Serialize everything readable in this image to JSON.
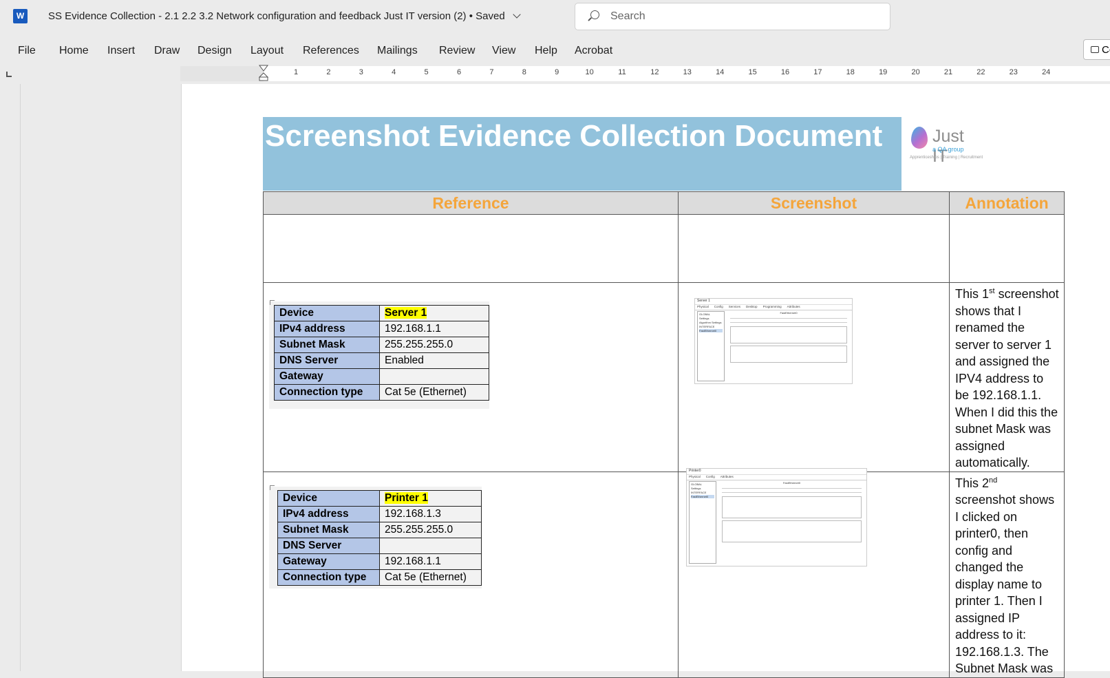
{
  "app": {
    "logo_letter": "W",
    "doc_title": "SS Evidence Collection - 2.1 2.2 3.2 Network configuration and feedback Just IT version (2)",
    "saved_status": "•  Saved",
    "search_placeholder": "Search"
  },
  "menu": [
    "File",
    "Home",
    "Insert",
    "Draw",
    "Design",
    "Layout",
    "References",
    "Mailings",
    "Review",
    "View",
    "Help",
    "Acrobat"
  ],
  "comments_button": "Co",
  "ruler": [
    "1",
    "2",
    "3",
    "4",
    "5",
    "6",
    "7",
    "8",
    "9",
    "10",
    "11",
    "12",
    "13",
    "14",
    "15",
    "16",
    "17",
    "18",
    "19",
    "20",
    "21",
    "22",
    "23",
    "24"
  ],
  "document": {
    "title": "Screenshot Evidence Collection Document",
    "logo": {
      "text": "Just IT",
      "sub": "a QA group",
      "tag": "Apprenticeships | Training | Recruitment"
    },
    "headers": {
      "reference": "Reference",
      "screenshot": "Screenshot",
      "annotation": "Annotation"
    },
    "rows": [
      {
        "ref": [
          [
            "Device",
            "Server 1"
          ],
          [
            "IPv4 address",
            "192.168.1.1"
          ],
          [
            "Subnet Mask",
            "255.255.255.0"
          ],
          [
            "DNS Server",
            "Enabled"
          ],
          [
            "Gateway",
            ""
          ],
          [
            "Connection type",
            "Cat 5e (Ethernet)"
          ]
        ],
        "annotation_pre": "This 1",
        "annotation_sup": "st",
        "annotation_post": " screenshot shows that I renamed the server to server 1 and assigned the IPV4 address to be 192.168.1.1. When I did this the subnet Mask was assigned automatically."
      },
      {
        "ref": [
          [
            "Device",
            "Printer 1"
          ],
          [
            "IPv4 address",
            "192.168.1.3"
          ],
          [
            "Subnet Mask",
            "255.255.255.0"
          ],
          [
            "DNS Server",
            ""
          ],
          [
            "Gateway",
            "192.168.1.1"
          ],
          [
            "Connection type",
            "Cat 5e (Ethernet)"
          ]
        ],
        "annotation_pre": "This 2",
        "annotation_sup": "nd",
        "annotation_post": " screenshot shows I clicked on printer0, then config and changed the display name to printer 1. Then I assigned IP address to it: 192.168.1.3. The Subnet Mask was"
      }
    ],
    "shots": [
      {
        "title": "Server 1",
        "tabs": [
          "Physical",
          "Config",
          "Services",
          "Desktop",
          "Programming",
          "Attributes"
        ],
        "side": [
          "GLOBAL",
          "Settings",
          "Algorithm Settings",
          "INTERFACE",
          "FastEthernet0"
        ],
        "panel": "FastEthernet0"
      },
      {
        "title": "Printer0",
        "tabs": [
          "Physical",
          "Config",
          "Attributes"
        ],
        "side": [
          "GLOBAL",
          "Settings",
          "INTERFACE",
          "FastEthernet0"
        ],
        "panel": "FastEthernet0"
      }
    ]
  }
}
